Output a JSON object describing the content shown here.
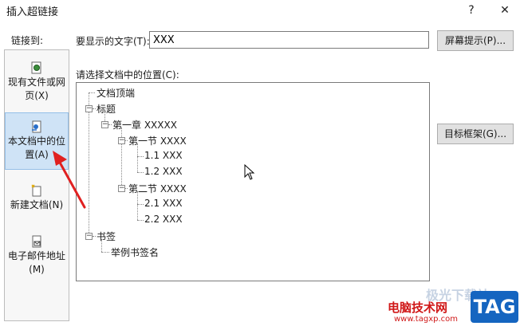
{
  "window": {
    "title": "插入超链接",
    "help_glyph": "?",
    "close_glyph": "✕"
  },
  "link_to": {
    "label": "链接到:",
    "items": [
      {
        "line1": "现有文件或网",
        "line2": "页(X)"
      },
      {
        "line1": "本文档中的位",
        "line2": "置(A)"
      },
      {
        "line1": "新建文档(N)",
        "line2": ""
      },
      {
        "line1": "电子邮件地址",
        "line2": "(M)"
      }
    ]
  },
  "display_text": {
    "label": "要显示的文字(T):",
    "value": "XXX"
  },
  "buttons": {
    "screen_tip": "屏幕提示(P)...",
    "target_frame": "目标框架(G)..."
  },
  "place": {
    "label": "请选择文档中的位置(C):"
  },
  "tree": [
    "文档顶端",
    "标题",
    "第一章 XXXXX",
    "第一节 XXXX",
    "1.1 XXX",
    "1.2 XXX",
    "第二节 XXXX",
    "2.1 XXX",
    "2.2 XXX",
    "书签",
    "举例书签名"
  ],
  "watermark": {
    "brand": "电脑技术网",
    "url": "www.tagxp.com",
    "tag": "TAG",
    "faint": "极光下载站"
  }
}
